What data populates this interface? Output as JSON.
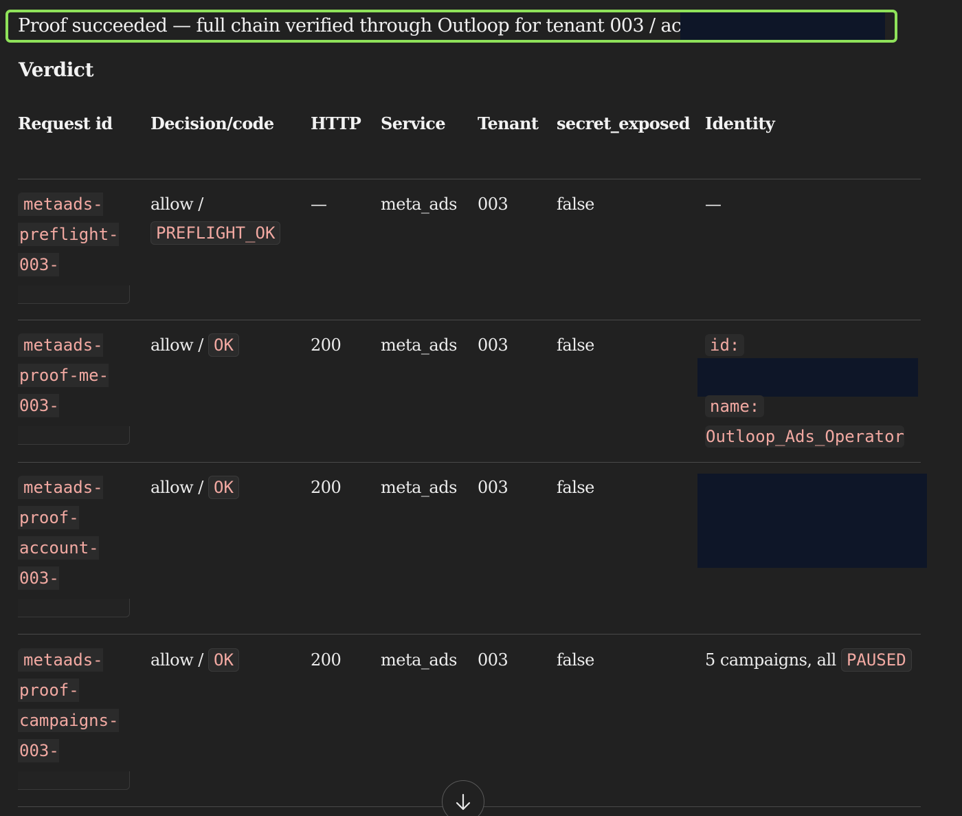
{
  "banner": {
    "text": "Proof succeeded — full chain verified through Outloop for tenant 003 / ac"
  },
  "section": {
    "heading": "Verdict"
  },
  "table": {
    "columns": [
      "Request id",
      "Decision/code",
      "HTTP",
      "Service",
      "Tenant",
      "secret_exposed",
      "Identity"
    ],
    "rows": [
      {
        "request_id_lines": [
          "metaads-",
          "preflight-",
          "003-"
        ],
        "decision": "allow /",
        "code": "PREFLIGHT_OK",
        "http": "—",
        "service": "meta_ads",
        "tenant": "003",
        "secret_exposed": "false",
        "identity": "—"
      },
      {
        "request_id_lines": [
          "metaads-",
          "proof-me-",
          "003-"
        ],
        "decision": "allow /",
        "code": "OK",
        "http": "200",
        "service": "meta_ads",
        "tenant": "003",
        "secret_exposed": "false",
        "identity_id_label": "id:",
        "identity_name_label": "name:",
        "identity_name_value": "Outloop_Ads_Operator"
      },
      {
        "request_id_lines": [
          "metaads-",
          "proof-",
          "account-",
          "003-"
        ],
        "decision": "allow /",
        "code": "OK",
        "http": "200",
        "service": "meta_ads",
        "tenant": "003",
        "secret_exposed": "false"
      },
      {
        "request_id_lines": [
          "metaads-",
          "proof-",
          "campaigns-",
          "003-"
        ],
        "decision": "allow /",
        "code": "OK",
        "http": "200",
        "service": "meta_ads",
        "tenant": "003",
        "secret_exposed": "false",
        "identity_text": "5 campaigns, all",
        "identity_code": "PAUSED"
      }
    ]
  },
  "scroll_button": {
    "icon": "arrow-down-icon"
  }
}
